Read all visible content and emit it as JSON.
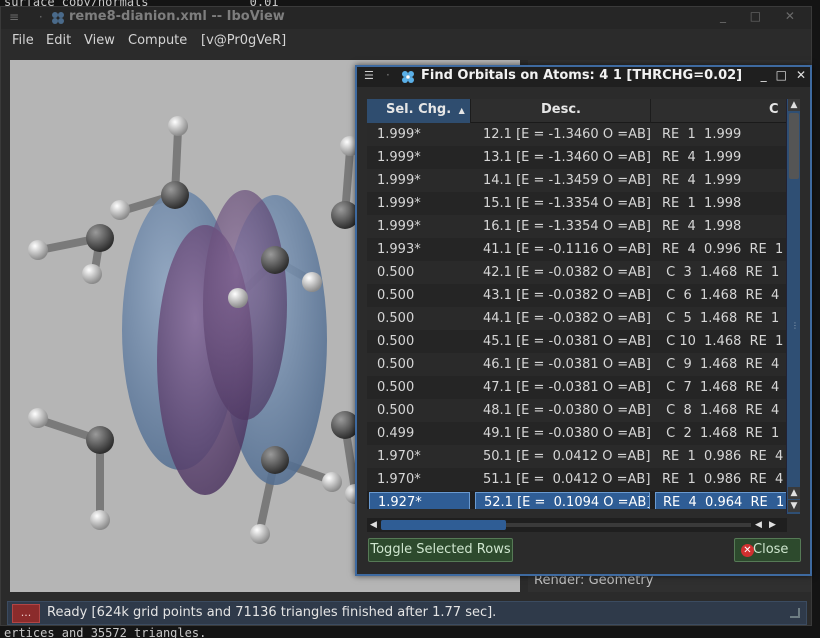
{
  "terminal": {
    "top_line": "surface copy/normals              0.01",
    "bottom_line": "ertices and 35572 triangles."
  },
  "window": {
    "title": "reme8-dianion.xml -- IboView",
    "menu": [
      "File",
      "Edit",
      "View",
      "Compute",
      "[v@Pr0gVeR]"
    ]
  },
  "right_pane": {
    "render_label": "Render: Geometry"
  },
  "status": {
    "button_label": "...",
    "text": "Ready [624k grid points and 71136 triangles finished after 1.77 sec]."
  },
  "dialog": {
    "title": "Find Orbitals on Atoms: 4 1 [THRCHG=0.02]",
    "columns": [
      {
        "label": "Sel. Chg.",
        "sort": "▲"
      },
      {
        "label": "Desc."
      },
      {
        "label": "C"
      }
    ],
    "rows": [
      {
        "chg": "1.999*",
        "desc": "12.1 [E = -1.3460 O =AB]",
        "atoms": "RE  1  1.999"
      },
      {
        "chg": "1.999*",
        "desc": "13.1 [E = -1.3460 O =AB]",
        "atoms": "RE  4  1.999"
      },
      {
        "chg": "1.999*",
        "desc": "14.1 [E = -1.3459 O =AB]",
        "atoms": "RE  4  1.999"
      },
      {
        "chg": "1.999*",
        "desc": "15.1 [E = -1.3354 O =AB]",
        "atoms": "RE  1  1.998"
      },
      {
        "chg": "1.999*",
        "desc": "16.1 [E = -1.3354 O =AB]",
        "atoms": "RE  4  1.998"
      },
      {
        "chg": "1.993*",
        "desc": "41.1 [E = -0.1116 O =AB]",
        "atoms": "RE  4  0.996  RE  1"
      },
      {
        "chg": "0.500",
        "desc": "42.1 [E = -0.0382 O =AB]",
        "atoms": " C  3  1.468  RE  1"
      },
      {
        "chg": "0.500",
        "desc": "43.1 [E = -0.0382 O =AB]",
        "atoms": " C  6  1.468  RE  4"
      },
      {
        "chg": "0.500",
        "desc": "44.1 [E = -0.0382 O =AB]",
        "atoms": " C  5  1.468  RE  1"
      },
      {
        "chg": "0.500",
        "desc": "45.1 [E = -0.0381 O =AB]",
        "atoms": " C 10  1.468  RE  1"
      },
      {
        "chg": "0.500",
        "desc": "46.1 [E = -0.0381 O =AB]",
        "atoms": " C  9  1.468  RE  4"
      },
      {
        "chg": "0.500",
        "desc": "47.1 [E = -0.0381 O =AB]",
        "atoms": " C  7  1.468  RE  4"
      },
      {
        "chg": "0.500",
        "desc": "48.1 [E = -0.0380 O =AB]",
        "atoms": " C  8  1.468  RE  4"
      },
      {
        "chg": "0.499",
        "desc": "49.1 [E = -0.0380 O =AB]",
        "atoms": " C  2  1.468  RE  1"
      },
      {
        "chg": "1.970*",
        "desc": "50.1 [E =  0.0412 O =AB]",
        "atoms": "RE  1  0.986  RE  4"
      },
      {
        "chg": "1.970*",
        "desc": "51.1 [E =  0.0412 O =AB]",
        "atoms": "RE  1  0.986  RE  4"
      },
      {
        "chg": "1.927*",
        "desc": "52.1 [E =  0.1094 O =AB]",
        "atoms": "RE  4  0.964  RE  1",
        "selected": true
      }
    ],
    "buttons": {
      "toggle": "Toggle Selected Rows",
      "close": "Close"
    }
  },
  "colors": {
    "accent": "#2f5d95",
    "dialog_border": "#3e6aa0",
    "status_bar": "#2f3a4a",
    "button_green": "#2d4a2d",
    "close_red": "#d03030"
  }
}
